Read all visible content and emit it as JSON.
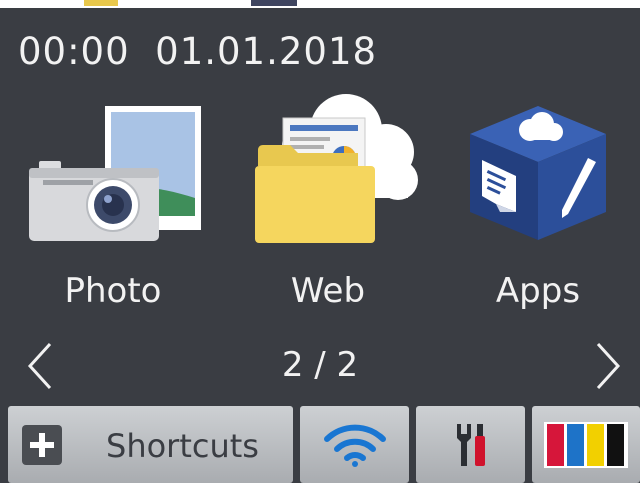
{
  "status_bar": {
    "time": "00:00",
    "date": "01.01.2018"
  },
  "apps": [
    {
      "label": "Photo",
      "icon": "photo-camera-icon"
    },
    {
      "label": "Web",
      "icon": "web-folder-cloud-icon"
    },
    {
      "label": "Apps",
      "icon": "apps-cube-icon"
    }
  ],
  "pagination": {
    "current": 2,
    "total": 2,
    "text": "2 / 2"
  },
  "bottom_bar": {
    "shortcuts_label": "Shortcuts",
    "wifi_icon": "wifi-icon",
    "tools_icon": "tools-icon",
    "ink_icon": "ink-toner-icon"
  },
  "colors": {
    "screen_background": "#3a3d43",
    "text": "#f2f2f2",
    "button": "#bdc0c3",
    "wifi": "#1976d2",
    "ink_black": "#111111",
    "ink_yellow": "#f2d000",
    "ink_cyan": "#1e73c8",
    "ink_magenta": "#d6163a"
  }
}
